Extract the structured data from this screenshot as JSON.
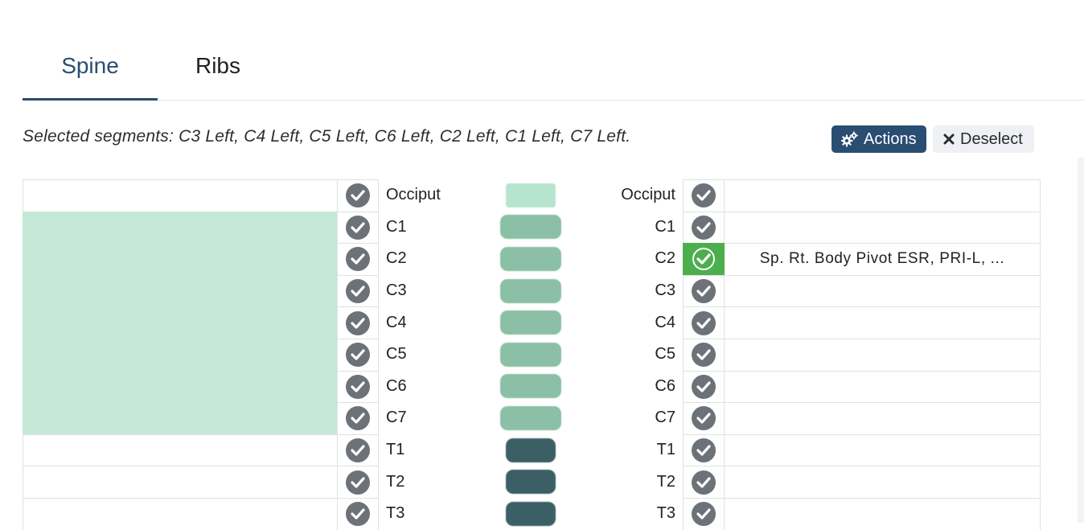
{
  "tabs": [
    {
      "label": "Spine",
      "active": true
    },
    {
      "label": "Ribs",
      "active": false
    }
  ],
  "summary": {
    "text": "Selected segments: C3 Left, C4 Left, C5 Left, C6 Left, C2 Left, C1 Left, C7 Left."
  },
  "toolbar": {
    "actions_label": "Actions",
    "deselect_label": "Deselect"
  },
  "colors": {
    "accent": "#2a4d72",
    "selected_row": "#c6e8d9",
    "active_check": "#4cae4c",
    "cervical_vertebra": "#8bbfa6",
    "thoracic_vertebra": "#3c5f66"
  },
  "segments": [
    {
      "name": "Occiput",
      "left_selected": false,
      "right_note": "",
      "right_active": false,
      "kind": "occiput"
    },
    {
      "name": "C1",
      "left_selected": true,
      "right_note": "",
      "right_active": false,
      "kind": "cervical"
    },
    {
      "name": "C2",
      "left_selected": true,
      "right_note": "Sp. Rt. Body Pivot ESR, PRI-L, ...",
      "right_active": true,
      "kind": "cervical"
    },
    {
      "name": "C3",
      "left_selected": true,
      "right_note": "",
      "right_active": false,
      "kind": "cervical"
    },
    {
      "name": "C4",
      "left_selected": true,
      "right_note": "",
      "right_active": false,
      "kind": "cervical"
    },
    {
      "name": "C5",
      "left_selected": true,
      "right_note": "",
      "right_active": false,
      "kind": "cervical"
    },
    {
      "name": "C6",
      "left_selected": true,
      "right_note": "",
      "right_active": false,
      "kind": "cervical"
    },
    {
      "name": "C7",
      "left_selected": true,
      "right_note": "",
      "right_active": false,
      "kind": "cervical"
    },
    {
      "name": "T1",
      "left_selected": false,
      "right_note": "",
      "right_active": false,
      "kind": "thoracic"
    },
    {
      "name": "T2",
      "left_selected": false,
      "right_note": "",
      "right_active": false,
      "kind": "thoracic"
    },
    {
      "name": "T3",
      "left_selected": false,
      "right_note": "",
      "right_active": false,
      "kind": "thoracic"
    }
  ]
}
